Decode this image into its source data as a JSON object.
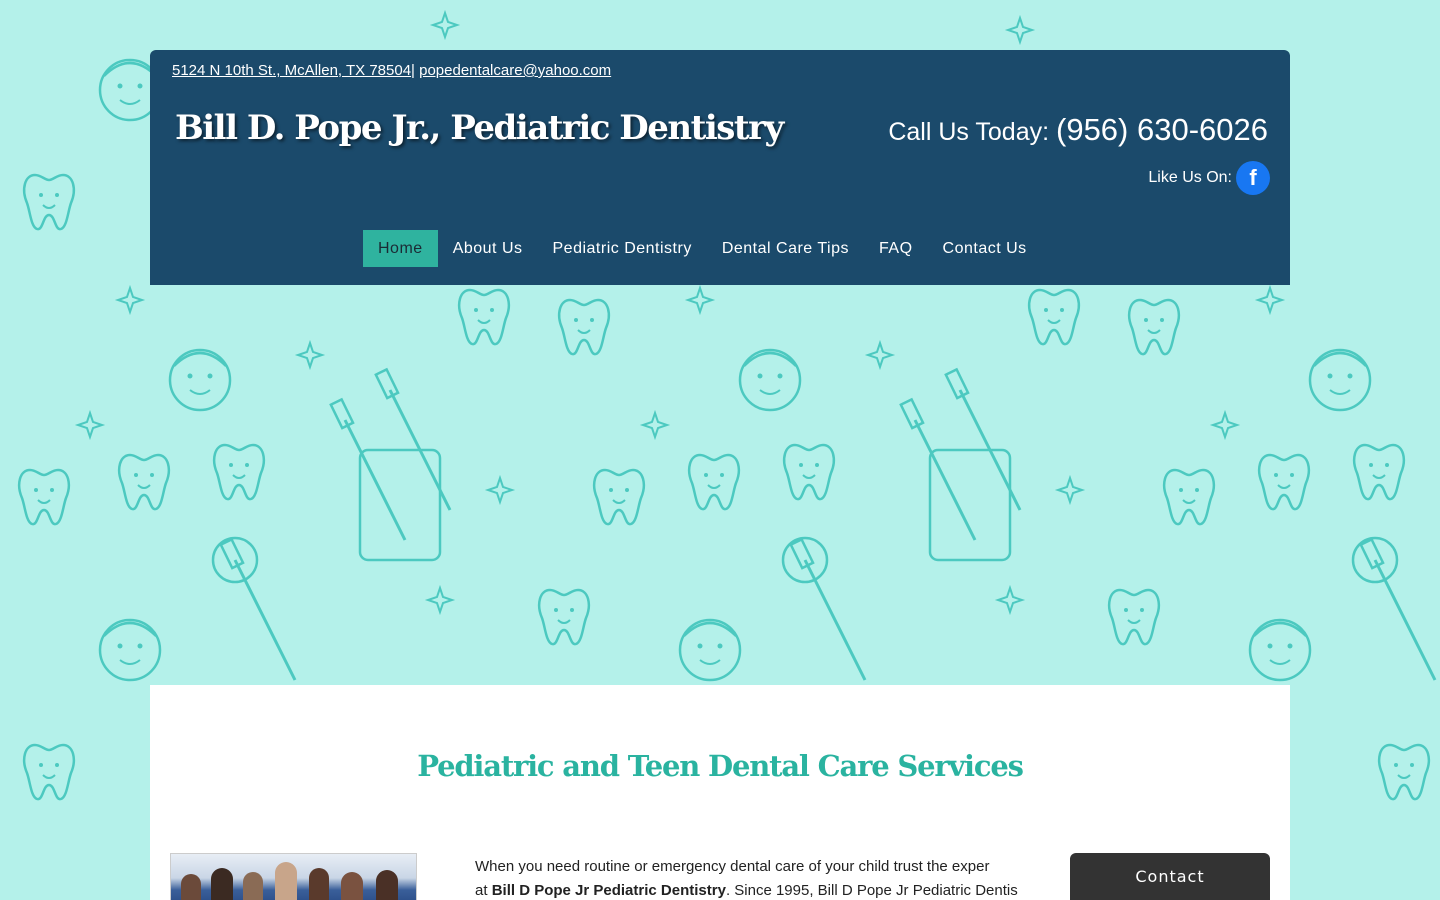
{
  "header": {
    "address": "5124 N 10th St., McAllen, TX 78504",
    "separator": "|",
    "email": "popedentalcare@yahoo.com",
    "site_title": "Bill D. Pope Jr., Pediatric Dentistry",
    "call_label": "Call Us Today: ",
    "phone": "(956) 630-6026",
    "like_label": "Like Us On:",
    "facebook_icon": "f"
  },
  "nav": {
    "items": [
      {
        "label": "Home",
        "active": true
      },
      {
        "label": "About Us",
        "active": false
      },
      {
        "label": "Pediatric Dentistry",
        "active": false
      },
      {
        "label": "Dental Care Tips",
        "active": false
      },
      {
        "label": "FAQ",
        "active": false
      },
      {
        "label": "Contact Us",
        "active": false
      }
    ]
  },
  "content": {
    "title": "Pediatric and Teen Dental Care Services",
    "intro_line1": "When you need routine or emergency dental care of your child trust the exper",
    "intro_line2_prefix": "at ",
    "intro_line2_bold": "Bill D Pope Jr Pediatric Dentistry",
    "intro_line2_rest": ". Since 1995, Bill D Pope Jr Pediatric Dentis"
  },
  "widget": {
    "contact_label": "Contact"
  },
  "colors": {
    "background": "#b4f1ea",
    "pattern": "#4cc9c0",
    "header": "#1b4a6b",
    "nav_active": "#2fb39f",
    "title_accent": "#2ab3a0",
    "facebook": "#1877f2"
  }
}
